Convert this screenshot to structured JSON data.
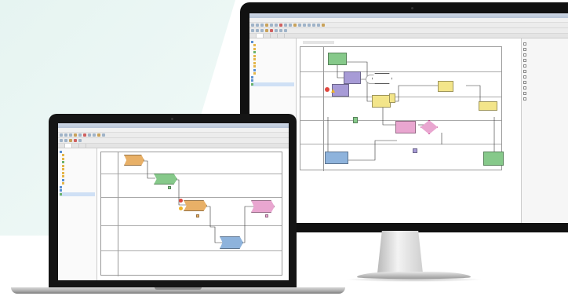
{
  "colors": {
    "background_tint": "#e6f4f1",
    "device_frame": "#111111",
    "node_orange": "#e8b067",
    "node_green": "#86c98a",
    "node_purple": "#a79bd6",
    "node_pink": "#e9a6d0",
    "node_yellow": "#f3e58a",
    "node_blue": "#8eb3dc"
  },
  "desktop": {
    "tabs": [
      "",
      "",
      "",
      "",
      ""
    ],
    "tree_items": [
      "",
      "",
      "",
      "",
      "",
      "",
      "",
      "",
      "",
      "",
      "",
      "",
      ""
    ],
    "lanes": [
      "",
      "",
      "",
      "",
      ""
    ],
    "nodes": [
      "",
      "",
      "",
      "",
      "",
      "",
      "",
      "",
      "",
      "",
      "",
      "",
      ""
    ],
    "panel_items": [
      "",
      "",
      "",
      "",
      "",
      "",
      "",
      "",
      "",
      "",
      ""
    ]
  },
  "laptop": {
    "tabs": [
      "",
      "",
      "",
      ""
    ],
    "tree_items": [
      "",
      "",
      "",
      "",
      "",
      "",
      "",
      "",
      "",
      "",
      "",
      "",
      ""
    ],
    "lanes": [
      "",
      "",
      "",
      "",
      ""
    ],
    "nodes": [
      "",
      "",
      "",
      "",
      "",
      "",
      "",
      ""
    ]
  }
}
